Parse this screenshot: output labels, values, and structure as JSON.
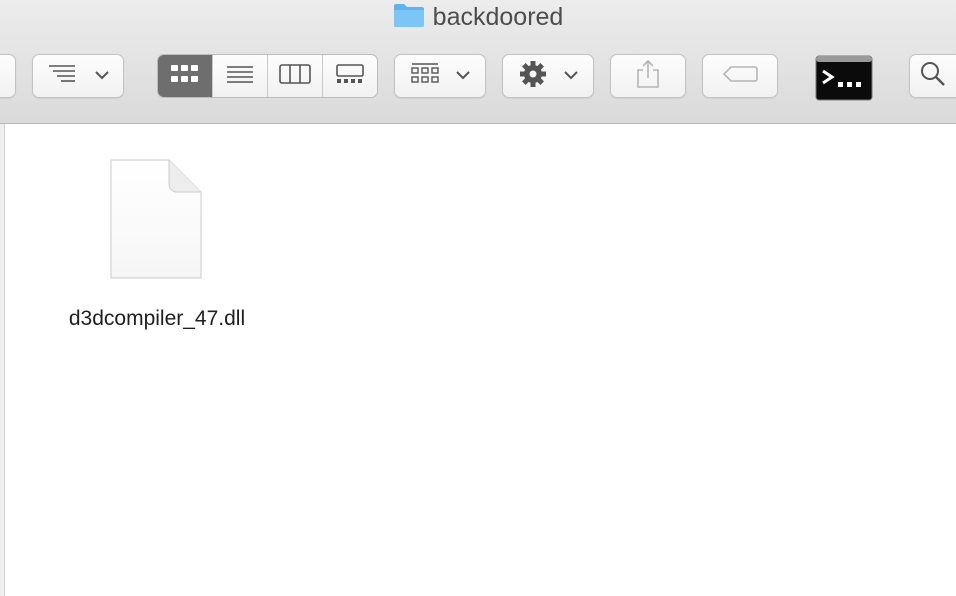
{
  "window": {
    "title": "backdoored",
    "title_icon": "folder-icon"
  },
  "toolbar": {
    "buttons": [
      {
        "name": "sidebar-toggle-button",
        "icon": "sidebar-icon"
      },
      {
        "name": "arrange-list-button",
        "icon": "list-indent-icon",
        "dropdown": true
      },
      {
        "name": "view-icon-button",
        "icon": "grid-icon",
        "active": true
      },
      {
        "name": "view-list-button",
        "icon": "list-icon"
      },
      {
        "name": "view-columns-button",
        "icon": "columns-icon"
      },
      {
        "name": "view-gallery-button",
        "icon": "gallery-icon"
      },
      {
        "name": "group-button",
        "icon": "group-grid-icon",
        "dropdown": true
      },
      {
        "name": "action-button",
        "icon": "gear-icon",
        "dropdown": true
      },
      {
        "name": "share-button",
        "icon": "share-icon"
      },
      {
        "name": "tag-button",
        "icon": "tag-icon"
      },
      {
        "name": "terminal-button",
        "icon": "terminal-icon"
      },
      {
        "name": "search-button",
        "icon": "search-icon"
      }
    ]
  },
  "files": [
    {
      "name": "d3dcompiler_47.dll",
      "icon": "document-icon"
    }
  ],
  "colors": {
    "toolbar_bg": "#e3e3e3",
    "active_segment": "#6e6e6e",
    "folder_blue": "#6bbdf5"
  }
}
